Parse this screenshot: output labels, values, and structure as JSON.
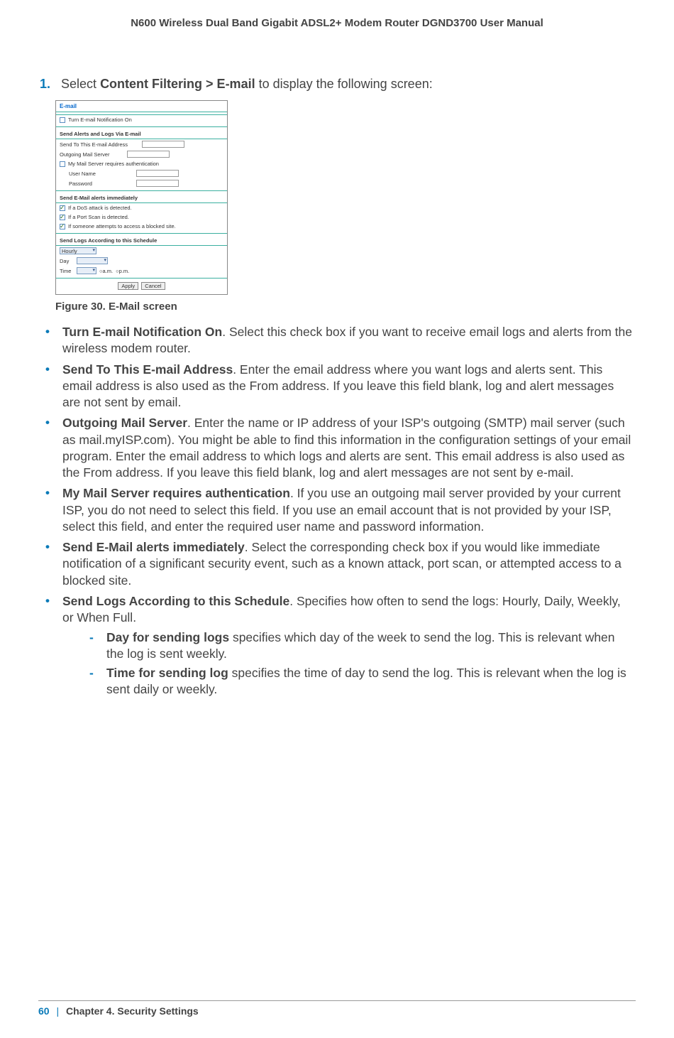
{
  "header": {
    "title": "N600 Wireless Dual Band Gigabit ADSL2+ Modem Router DGND3700 User Manual"
  },
  "step": {
    "num": "1.",
    "pre": "Select ",
    "bold": "Content Filtering > E-mail",
    "post": " to display the following screen:"
  },
  "screenshot": {
    "title": "E-mail",
    "notify": "Turn E-mail Notification On",
    "sec1": "Send Alerts and Logs Via E-mail",
    "row_send": "Send To This E-mail Address",
    "row_server": "Outgoing Mail Server",
    "row_auth": "My Mail Server requires authentication",
    "row_user": "User Name",
    "row_pass": "Password",
    "sec2": "Send E-Mail alerts immediately",
    "alert1": "If a DoS attack is detected.",
    "alert2": "If a Port Scan is detected.",
    "alert3": "If someone attempts to access a blocked site.",
    "sec3": "Send Logs According to this Schedule",
    "sched_sel": "Hourly",
    "row_day": "Day",
    "row_time": "Time",
    "ampm_a": "a.m.",
    "ampm_p": "p.m.",
    "btn_apply": "Apply",
    "btn_cancel": "Cancel"
  },
  "caption": {
    "text": "Figure 30.  E-Mail screen"
  },
  "bullets": [
    {
      "bold": "Turn E-mail Notification On",
      "text": ". Select this check box if you want to receive email logs and alerts from the wireless modem router."
    },
    {
      "bold": "Send To This E-mail Address",
      "text": ". Enter the email address where you want logs and alerts sent. This email address is also used as the From address. If you leave this field blank, log and alert messages are not sent by email."
    },
    {
      "bold": "Outgoing Mail Server",
      "text": ". Enter the name or IP address of your ISP's outgoing (SMTP) mail server (such as mail.myISP.com). You might be able to find this information in the configuration settings of your email program. Enter the email address to which logs and alerts are sent. This email address is also used as the From address. If you leave this field blank, log and alert messages are not sent by e-mail."
    },
    {
      "bold": "My Mail Server requires authentication",
      "text": ". If you use an outgoing mail server provided by your current ISP, you do not need to select this field. If you use an email account that is not provided by your ISP, select this field, and enter the required user name and password information."
    },
    {
      "bold": "Send E-Mail alerts immediately",
      "text": ". Select the corresponding check box if you would like immediate notification of a significant security event, such as a known attack, port scan, or attempted access to a blocked site."
    },
    {
      "bold": "Send Logs According to this Schedule",
      "text": ". Specifies how often to send the logs: Hourly, Daily, Weekly, or When Full."
    }
  ],
  "subs": [
    {
      "bold": "Day for sending logs",
      "text": " specifies which day of the week to send the log. This is relevant when the log is sent weekly."
    },
    {
      "bold": "Time for sending log",
      "text": " specifies the time of day to send the log. This is relevant when the log is sent daily or weekly."
    }
  ],
  "footer": {
    "page": "60",
    "sep": "|",
    "chapter": "Chapter 4.  Security Settings"
  }
}
